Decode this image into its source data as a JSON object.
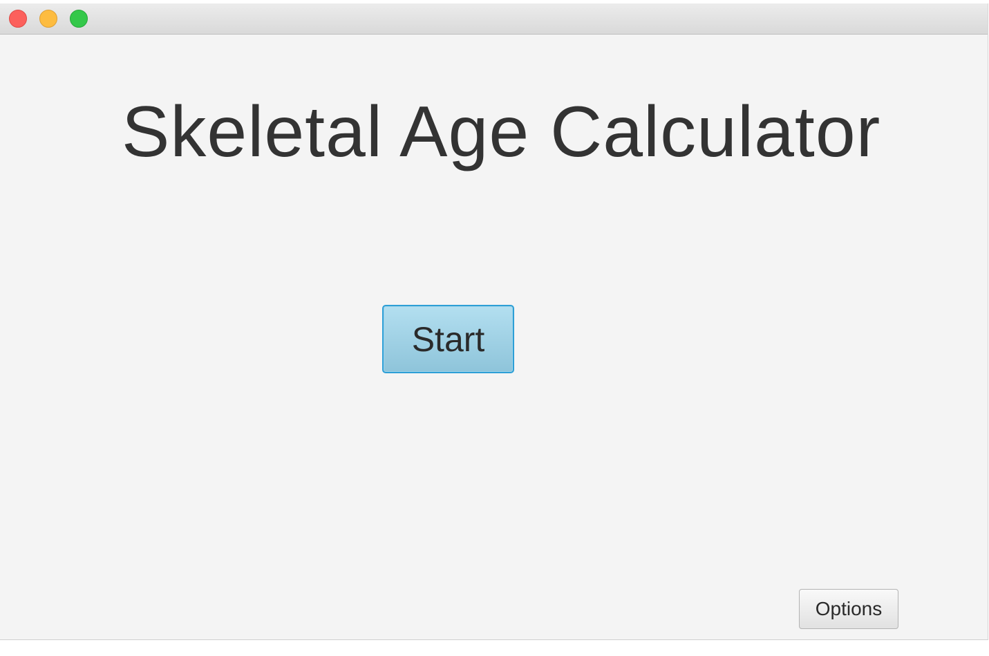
{
  "window": {
    "title_bar": {
      "controls": [
        "close",
        "minimize",
        "zoom"
      ],
      "colors": {
        "close": "#fc605c",
        "minimize": "#fdbc40",
        "zoom": "#34c84a"
      }
    }
  },
  "main": {
    "title": "Skeletal Age Calculator",
    "start_label": "Start",
    "options_label": "Options",
    "accent_color": "#2d9fd6"
  }
}
